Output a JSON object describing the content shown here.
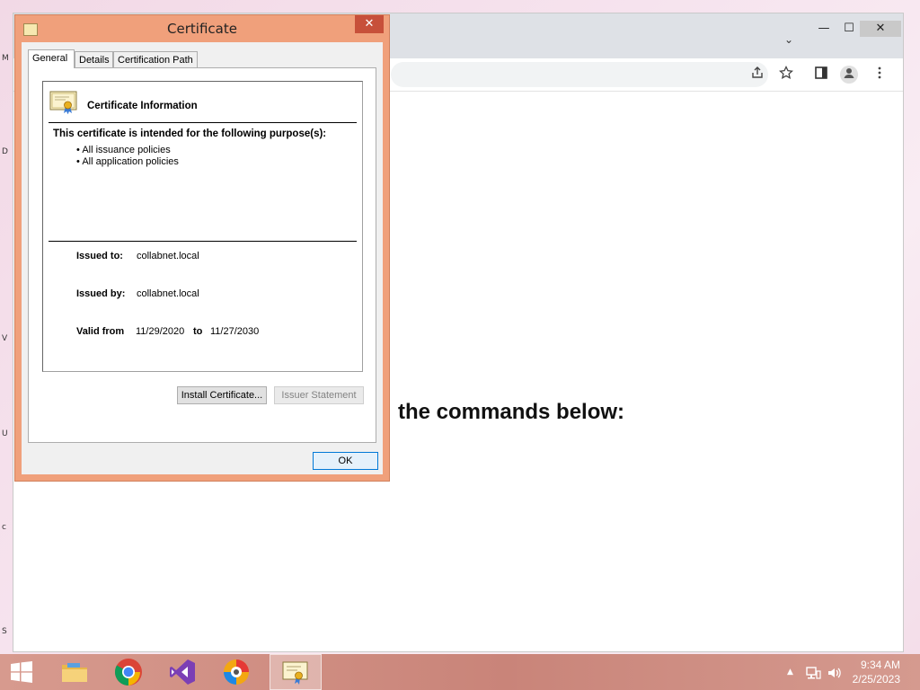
{
  "desktop": {
    "edge_letters": [
      "M",
      "D",
      "V",
      "U",
      "c",
      "S"
    ]
  },
  "browser": {
    "chevron": "⌄",
    "min": "—",
    "max": "☐",
    "close": "✕",
    "toolbar_icons": [
      "share-icon",
      "star-icon",
      "sidepanel-icon",
      "profile-icon",
      "menu-icon"
    ],
    "page_heading_fragment": "the commands below:"
  },
  "dialog": {
    "title": "Certificate",
    "close_glyph": "✕",
    "tabs": [
      "General",
      "Details",
      "Certification Path"
    ],
    "info_title": "Certificate Information",
    "purpose_heading": "This certificate is intended for the following purpose(s):",
    "purposes": [
      "All issuance policies",
      "All application policies"
    ],
    "issued_to_label": "Issued to:",
    "issued_to_value": "collabnet.local",
    "issued_by_label": "Issued by:",
    "issued_by_value": "collabnet.local",
    "valid_from_label": "Valid from",
    "valid_from_value": "11/29/2020",
    "valid_to_label": "to",
    "valid_to_value": "11/27/2030",
    "install_button": "Install Certificate...",
    "issuer_button": "Issuer Statement",
    "ok_button": "OK"
  },
  "taskbar": {
    "apps": [
      "windows-start",
      "file-explorer",
      "chrome",
      "visual-studio",
      "browser-app",
      "certificate-app"
    ],
    "clock_time": "9:34 AM",
    "clock_date": "2/25/2023"
  },
  "colors": {
    "dialog_frame": "#f0a07b",
    "close_red": "#c7503a",
    "taskbar": "#c98479"
  }
}
